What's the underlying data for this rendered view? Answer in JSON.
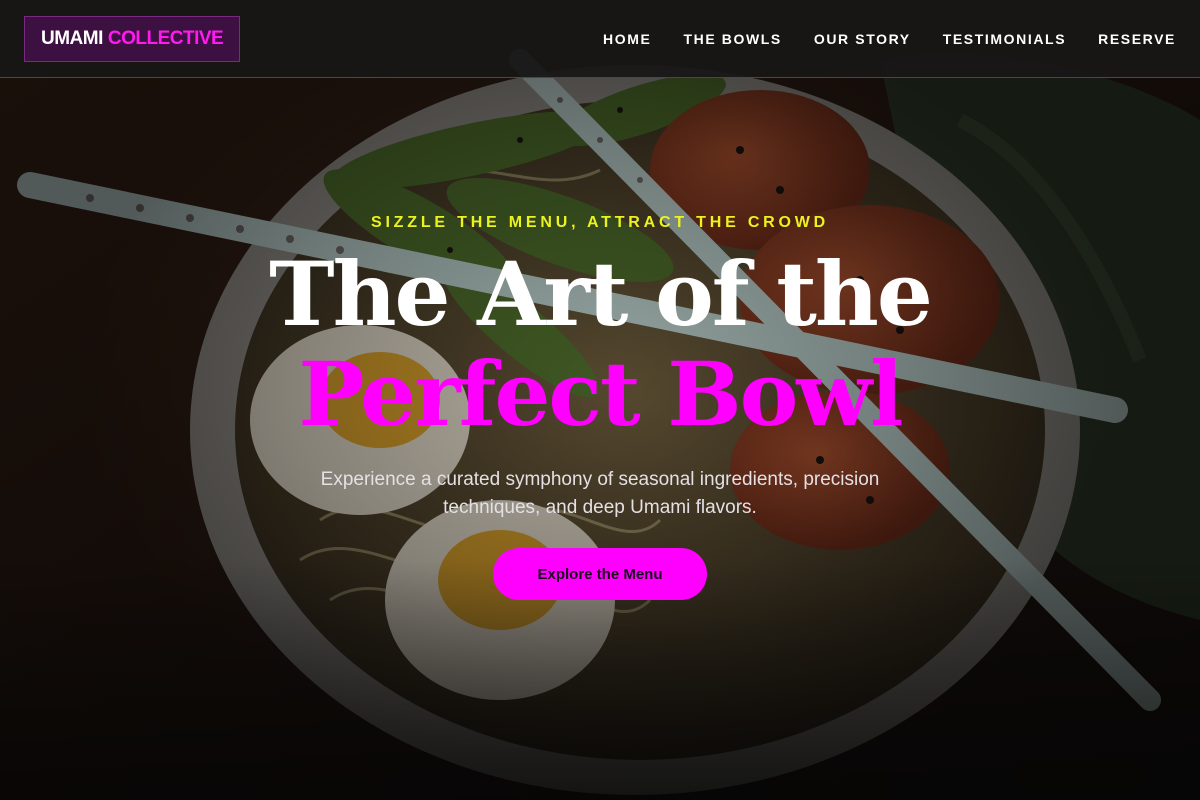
{
  "colors": {
    "accent_magenta": "#ff00ff",
    "eyebrow_yellow": "#ecf21f",
    "header_bg": "#181616",
    "logo_bg": "#3c1040"
  },
  "header": {
    "logo_primary": "UMAMI",
    "logo_accent": "COLLECTIVE",
    "nav": [
      {
        "label": "HOME"
      },
      {
        "label": "THE BOWLS"
      },
      {
        "label": "OUR STORY"
      },
      {
        "label": "TESTIMONIALS"
      },
      {
        "label": "RESERVE"
      }
    ]
  },
  "hero": {
    "eyebrow": "SIZZLE THE MENU, ATTRACT THE CROWD",
    "headline_line1": "The Art of the",
    "headline_line2": "Perfect Bowl",
    "subtitle": "Experience a curated symphony of seasonal ingredients, precision techniques, and deep Umami flavors.",
    "cta_label": "Explore the Menu",
    "background_image": "ramen-bowl-photo"
  }
}
